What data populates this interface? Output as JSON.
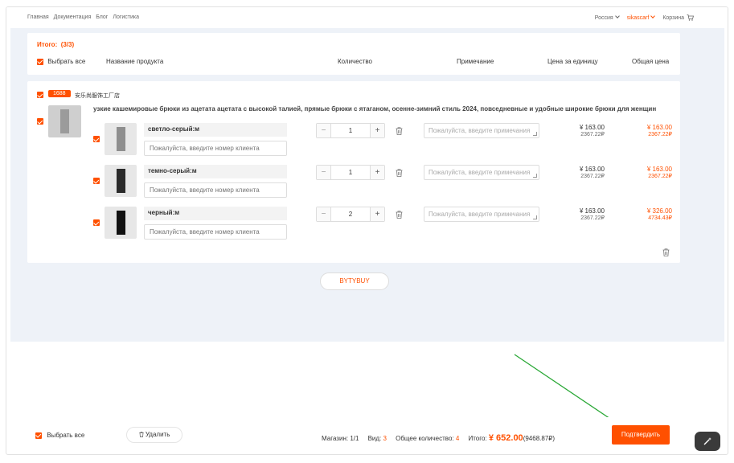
{
  "nav": {
    "links": [
      "Главная",
      "Документация",
      "Блог",
      "Логистика"
    ],
    "country": "Россия",
    "user": "sikascarf",
    "cart": "Корзина"
  },
  "summary": {
    "total_label": "Итого:",
    "total_count": "(3/3)",
    "select_all": "Выбрать все",
    "col_product": "Название продукта",
    "col_qty": "Количество",
    "col_note": "Примечание",
    "col_unit": "Цена за единицу",
    "col_total": "Общая цена"
  },
  "shop": {
    "badge": "1688",
    "name": "安乐尚服饰工厂店",
    "product_title": "узкие кашемировые брюки из ацетата ацетата с высокой талией, прямые брюки с ятаганом, осенне-зимний стиль 2024, повседневные и удобные широкие брюки для женщин",
    "variants": [
      {
        "name": "светло-серый:м",
        "qty": "1",
        "unit": "¥ 163.00",
        "unit_sub": "2367.22₽",
        "total": "¥ 163.00",
        "total_sub": "2367.22₽",
        "color": "#8e8e8e"
      },
      {
        "name": "темно-серый:м",
        "qty": "1",
        "unit": "¥ 163.00",
        "unit_sub": "2367.22₽",
        "total": "¥ 163.00",
        "total_sub": "2367.22₽",
        "color": "#2a2a2a"
      },
      {
        "name": "черный:м",
        "qty": "2",
        "unit": "¥ 163.00",
        "unit_sub": "2367.22₽",
        "total": "¥ 326.00",
        "total_sub": "4734.43₽",
        "color": "#111111"
      }
    ],
    "customer_placeholder": "Пожалуйста, введите номер клиента",
    "note_placeholder": "Пожалуйста, введите примечания"
  },
  "more_button": "BYTYBUY",
  "footer": {
    "select_all": "Выбрать все",
    "delete": "Удалить",
    "shops_label": "Магазин:",
    "shops_value": "1/1",
    "kinds_label": "Вид:",
    "kinds_value": "3",
    "qty_label": "Общее количество:",
    "qty_value": "4",
    "total_label": "Итого:",
    "total_value": "¥ 652.00",
    "total_rub": "(9468.87₽)",
    "confirm": "Подтвердить"
  },
  "colors": {
    "accent": "#ff5000",
    "annotation_arrow": "#2aa836"
  }
}
